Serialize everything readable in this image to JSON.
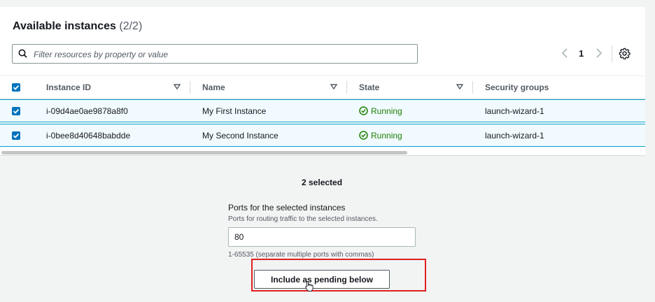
{
  "panel": {
    "title": "Available instances",
    "count": "(2/2)"
  },
  "search": {
    "placeholder": "Filter resources by property or value"
  },
  "pagination": {
    "current_page": "1"
  },
  "table": {
    "columns": [
      "Instance ID",
      "Name",
      "State",
      "Security groups"
    ],
    "rows": [
      {
        "instance_id": "i-09d4ae0ae9878a8f0",
        "name": "My First Instance",
        "state": "Running",
        "security_groups": "launch-wizard-1",
        "selected": true
      },
      {
        "instance_id": "i-0bee8d40648babdde",
        "name": "My Second Instance",
        "state": "Running",
        "security_groups": "launch-wizard-1",
        "selected": true
      }
    ]
  },
  "selection": {
    "summary": "2 selected"
  },
  "ports": {
    "label": "Ports for the selected instances",
    "description": "Ports for routing traffic to the selected instances.",
    "value": "80",
    "hint": "1-65535 (separate multiple ports with commas)"
  },
  "actions": {
    "include_label": "Include as pending below"
  },
  "colors": {
    "accent": "#0073bb",
    "running": "#1d8102",
    "highlight": "#e02020",
    "selected_row_bg": "#f1faff",
    "selected_row_border": "#00a1c9"
  }
}
